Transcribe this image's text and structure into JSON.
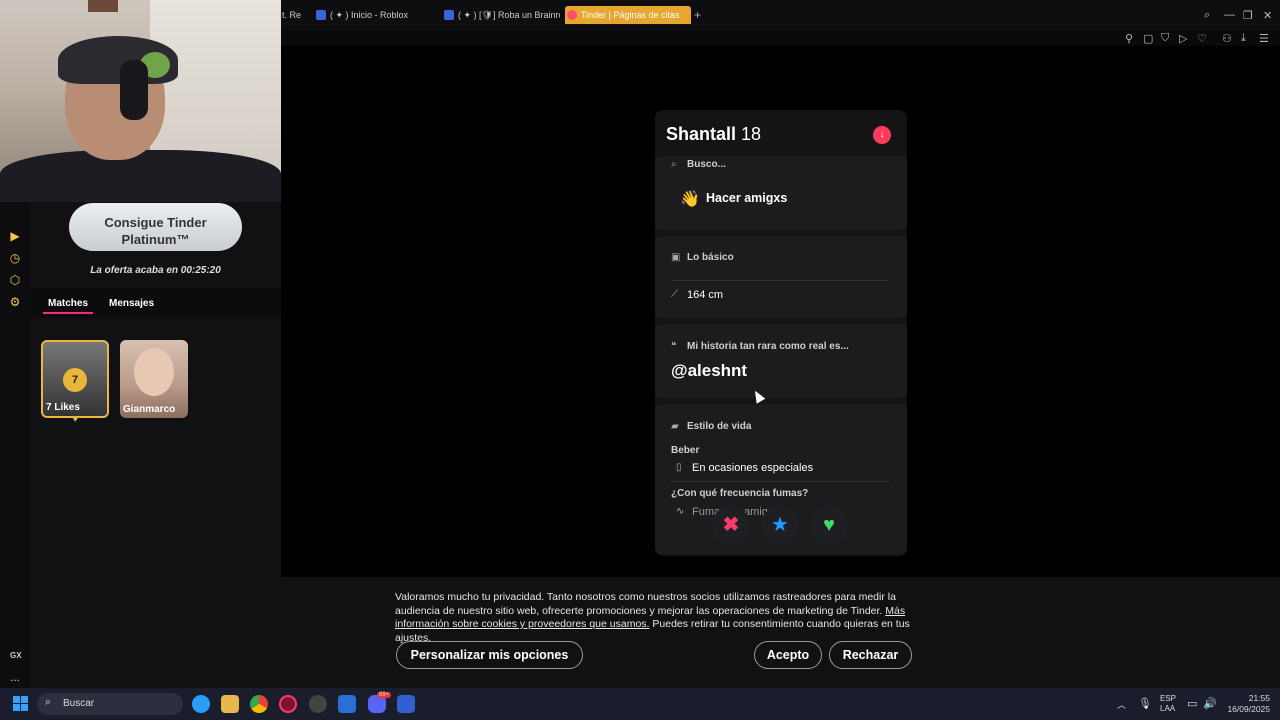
{
  "browser": {
    "tabs": [
      {
        "label": "t. Re"
      },
      {
        "label": "( ✦ ) Inicio - Roblox"
      },
      {
        "label": "( ✦ ) [🛡] Roba un Brainro"
      },
      {
        "label": "Tinder | Páginas de citas"
      }
    ]
  },
  "sidebar": {
    "platinum_button": "Consigue Tinder Platinum™",
    "offer_text": "La oferta acaba en 00:25:20",
    "tabs": {
      "matches": "Matches",
      "messages": "Mensajes"
    },
    "likes": {
      "count": "7",
      "label": "7 Likes"
    },
    "match": {
      "name": "Gianmarco"
    },
    "gx": "GX",
    "more": "..."
  },
  "profile": {
    "name": "Shantall",
    "age": "18",
    "looking_for_label": "Busco...",
    "looking_for_value": "Hacer amigxs",
    "basics_label": "Lo básico",
    "height": "164 cm",
    "story_label": "Mi historia tan rara como real es...",
    "story_value": "@aleshnt",
    "lifestyle_label": "Estilo de vida",
    "drink_label": "Beber",
    "drink_value": "En ocasiones especiales",
    "smoke_label": "¿Con qué frecuencia fumas?",
    "smoke_value": "Fuma con amigos"
  },
  "cookie": {
    "text": "Valoramos mucho tu privacidad. Tanto nosotros como nuestros socios utilizamos rastreadores para medir la audiencia de nuestro sitio web, ofrecerte promociones y mejorar las operaciones de marketing de Tinder.",
    "link": "Más información sobre cookies y proveedores que usamos.",
    "text_after": "Puedes retirar tu consentimiento cuando quieras en tus ajustes.",
    "customize": "Personalizar mis opciones",
    "accept": "Acepto",
    "reject": "Rechazar"
  },
  "taskbar": {
    "search": "Buscar",
    "lang_top": "ESP",
    "lang_bottom": "LAA",
    "time": "21:55",
    "date": "16/09/2025",
    "badge": "99+"
  },
  "colors": {
    "accent": "#fd267a",
    "gold": "#e9b53c",
    "tab_active": "#e6a630"
  }
}
